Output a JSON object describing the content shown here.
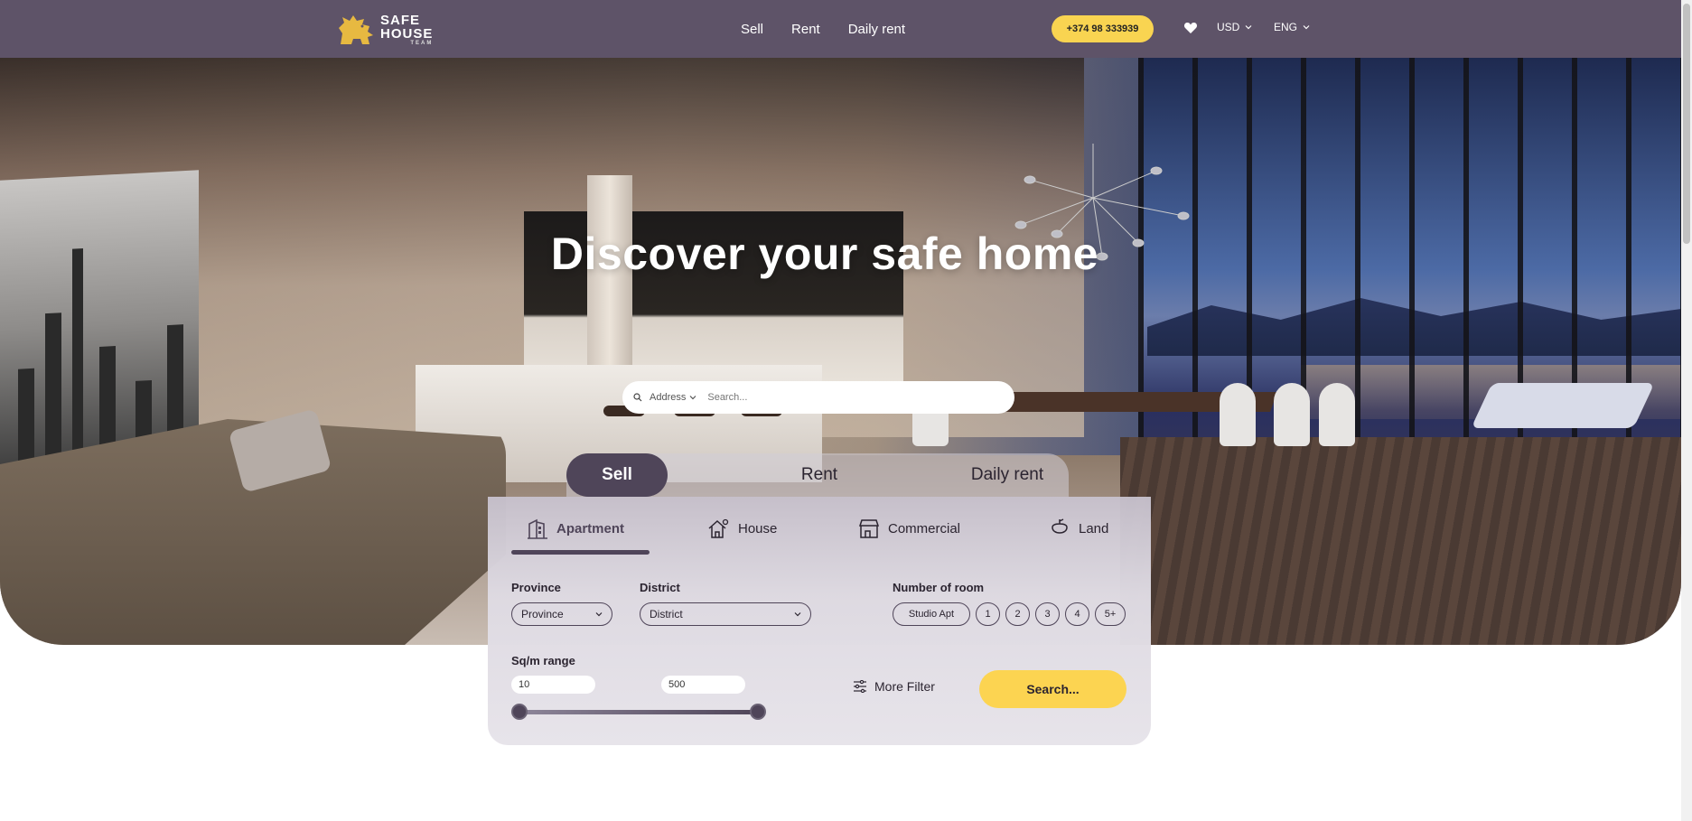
{
  "header": {
    "logo": {
      "line1": "SAFE",
      "line2": "HOUSE",
      "line3": "TEAM"
    },
    "nav": [
      "Sell",
      "Rent",
      "Daily rent"
    ],
    "phone": "+374 98 333939",
    "currency": "USD",
    "language": "ENG"
  },
  "hero": {
    "title": "Discover your safe home",
    "search": {
      "filter_label": "Address",
      "placeholder": "Search..."
    }
  },
  "deal_tabs": {
    "items": [
      "Sell",
      "Rent",
      "Daily rent"
    ],
    "active": "Sell"
  },
  "filters": {
    "property_types": [
      "Apartment",
      "House",
      "Commercial",
      "Land"
    ],
    "active_type": "Apartment",
    "province": {
      "label": "Province",
      "value": "Province"
    },
    "district": {
      "label": "District",
      "value": "District"
    },
    "rooms": {
      "label": "Number of room",
      "options": [
        "Studio Apt",
        "1",
        "2",
        "3",
        "4",
        "5+"
      ]
    },
    "sqm": {
      "label": "Sq/m range",
      "min": "10",
      "max": "500"
    },
    "more_filter": "More Filter",
    "search_button": "Search..."
  },
  "colors": {
    "header_bg": "#5e5368",
    "accent_yellow": "#fcd451",
    "primary_dark": "#4f4559"
  },
  "icons": [
    "logo-lion-icon",
    "heart-icon",
    "chevron-down-icon",
    "search-icon",
    "apartment-icon",
    "house-icon",
    "commercial-icon",
    "land-icon",
    "filter-sliders-icon"
  ]
}
